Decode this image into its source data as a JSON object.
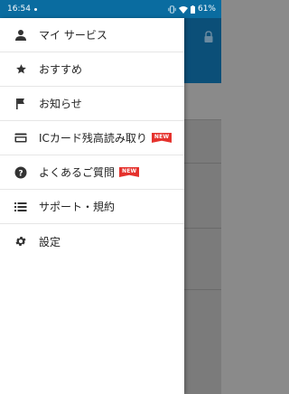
{
  "status": {
    "time": "16:54",
    "battery": "61%"
  },
  "drawer": {
    "items": [
      {
        "label": "マイ サービス",
        "icon": "person-icon"
      },
      {
        "label": "おすすめ",
        "icon": "star-icon"
      },
      {
        "label": "お知らせ",
        "icon": "flag-icon"
      },
      {
        "label": "ICカード残高読み取り",
        "icon": "card-icon",
        "badge": "NEW"
      },
      {
        "label": "よくあるご質問",
        "icon": "help-icon",
        "badge": "NEW"
      },
      {
        "label": "サポート・規約",
        "icon": "list-icon"
      },
      {
        "label": "設定",
        "icon": "gear-icon"
      }
    ]
  },
  "colors": {
    "statusbar": "#0a6ca0",
    "header": "#0b4f78",
    "badge": "#e5322d"
  }
}
